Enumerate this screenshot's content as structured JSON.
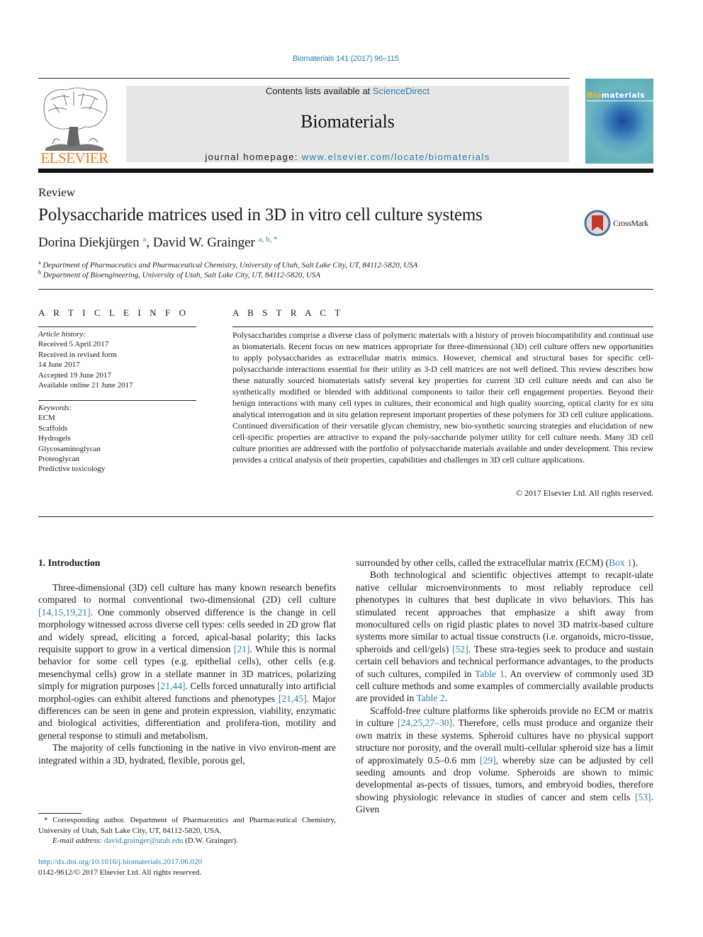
{
  "header": {
    "citation": "Biomaterials 141 (2017) 96–115",
    "publisher_logo_text": "ELSEVIER",
    "contents_prefix": "Contents lists available at ",
    "contents_link": "ScienceDirect",
    "journal_name": "Biomaterials",
    "homepage_prefix": "journal homepage: ",
    "homepage_link": "www.elsevier.com/locate/biomaterials",
    "cover_title_bi": "Bio",
    "cover_title_rest": "materials"
  },
  "article": {
    "type": "Review",
    "title": "Polysaccharide matrices used in 3D in vitro cell culture systems",
    "crossmark_label": "CrossMark",
    "authors": [
      {
        "name": "Dorina Diekjürgen",
        "sup": "a"
      },
      {
        "name": "David W. Grainger",
        "sup": "a, b, *"
      }
    ],
    "affiliations": [
      {
        "mark": "a",
        "text": "Department of Pharmaceutics and Pharmaceutical Chemistry, University of Utah, Salt Lake City, UT, 84112-5820, USA"
      },
      {
        "mark": "b",
        "text": "Department of Bioengineering, University of Utah, Salt Lake City, UT, 84112-5820, USA"
      }
    ]
  },
  "article_info": {
    "heading": "A R T I C L E   I N F O",
    "history_label": "Article history:",
    "history": [
      "Received 5 April 2017",
      "Received in revised form",
      "14 June 2017",
      "Accepted 19 June 2017",
      "Available online 21 June 2017"
    ],
    "keywords_label": "Keywords:",
    "keywords": [
      "ECM",
      "Scaffolds",
      "Hydrogels",
      "Glycosaminoglycan",
      "Proteoglycan",
      "Predictive toxicology"
    ]
  },
  "abstract": {
    "heading": "A B S T R A C T",
    "text": "Polysaccharides comprise a diverse class of polymeric materials with a history of proven biocompatibility and continual use as biomaterials. Recent focus on new matrices appropriate for three-dimensional (3D) cell culture offers new opportunities to apply polysaccharides as extracellular matrix mimics. However, chemical and structural bases for specific cell-polysaccharide interactions essential for their utility as 3-D cell matrices are not well defined. This review describes how these naturally sourced biomaterials satisfy several key properties for current 3D cell culture needs and can also be synthetically modified or blended with additional components to tailor their cell engagement properties. Beyond their benign interactions with many cell types in cultures, their economical and high quality sourcing, optical clarity for ex situ analytical interrogation and in situ gelation represent important properties of these polymers for 3D cell culture applications. Continued diversification of their versatile glycan chemistry, new bio-synthetic sourcing strategies and elucidation of new cell-specific properties are attractive to expand the poly-saccharide polymer utility for cell culture needs. Many 3D cell culture priorities are addressed with the portfolio of polysaccharide materials available and under development. This review provides a critical analysis of their properties, capabilities and challenges in 3D cell culture applications.",
    "copyright": "© 2017 Elsevier Ltd. All rights reserved."
  },
  "body": {
    "section_heading": "1.  Introduction",
    "left": {
      "p1": [
        {
          "t": "Three-dimensional (3D) cell culture has many known research benefits compared to normal conventional two-dimensional (2D) cell culture "
        },
        {
          "t": "[14,15,19,21]",
          "link": true
        },
        {
          "t": ". One commonly observed difference is the change in cell morphology witnessed across diverse cell types: cells seeded in 2D grow flat and widely spread, eliciting a forced, apical-basal polarity; this lacks requisite support to grow in a vertical dimension "
        },
        {
          "t": "[21]",
          "link": true
        },
        {
          "t": ". While this is normal behavior for some cell types (e.g. epithelial cells), other cells (e.g. mesenchymal cells) grow in a stellate manner in 3D matrices, polarizing simply for migration purposes "
        },
        {
          "t": "[21,44]",
          "link": true
        },
        {
          "t": ". Cells forced unnaturally into artificial morphol-ogies can exhibit altered functions and phenotypes "
        },
        {
          "t": "[21,45]",
          "link": true
        },
        {
          "t": ". Major differences can be seen in gene and protein expression, viability, enzymatic and biological activities, differentiation and prolifera-tion, motility and general response to stimuli and metabolism."
        }
      ],
      "p2": [
        {
          "t": "The majority of cells functioning in the native in vivo environ-ment are integrated within a 3D, hydrated, flexible, porous gel,"
        }
      ]
    },
    "right": {
      "p0": [
        {
          "t": "surrounded by other cells, called the extracellular matrix (ECM) ("
        },
        {
          "t": "Box 1",
          "link": true
        },
        {
          "t": ")."
        }
      ],
      "p1": [
        {
          "t": "Both technological and scientific objectives attempt to recapit-ulate native cellular microenvironments to most reliably reproduce cell phenotypes in cultures that best duplicate in vivo behaviors. This has stimulated recent approaches that emphasize a shift away from monocultured cells on rigid plastic plates to novel 3D matrix-based culture systems more similar to actual tissue constructs (i.e. organoids, micro-tissue, spheroids and cell/gels) "
        },
        {
          "t": "[52]",
          "link": true
        },
        {
          "t": ". These stra-tegies seek to produce and sustain certain cell behaviors and technical performance advantages, to the products of such cultures, compiled in "
        },
        {
          "t": "Table 1",
          "link": true
        },
        {
          "t": ". An overview of commonly used 3D cell culture methods and some examples of commercially available products are provided in "
        },
        {
          "t": "Table 2",
          "link": true
        },
        {
          "t": "."
        }
      ],
      "p2": [
        {
          "t": "Scaffold-free culture platforms like spheroids provide no ECM or matrix in culture "
        },
        {
          "t": "[24,25,27–30]",
          "link": true
        },
        {
          "t": ". Therefore, cells must produce and organize their own matrix in these systems. Spheroid cultures have no physical support structure nor porosity, and the overall multi-cellular spheroid size has a limit of approximately 0.5–0.6 mm "
        },
        {
          "t": "[29]",
          "link": true
        },
        {
          "t": ", whereby size can be adjusted by cell seeding amounts and drop volume. Spheroids are shown to mimic developmental as-pects of tissues, tumors, and embryoid bodies, therefore showing physiologic relevance in studies of cancer and stem cells "
        },
        {
          "t": "[53]",
          "link": true
        },
        {
          "t": ". Given"
        }
      ]
    }
  },
  "footnotes": {
    "corresponding": "* Corresponding author. Department of Pharmaceutics and Pharmaceutical Chemistry, University of Utah, Salt Lake City, UT, 84112-5820, USA.",
    "email_label": "E-mail address: ",
    "email": "david.grainger@utah.edu",
    "email_suffix": " (D.W. Grainger).",
    "doi": "http://dx.doi.org/10.1016/j.biomaterials.2017.06.020",
    "issn": "0142-9612/© 2017 Elsevier Ltd. All rights reserved."
  }
}
